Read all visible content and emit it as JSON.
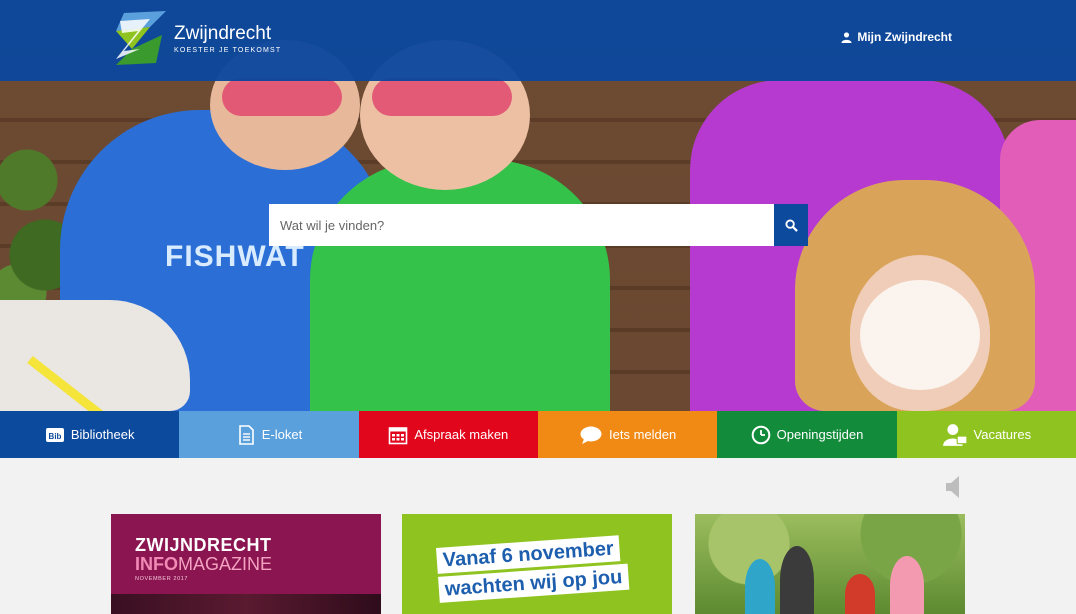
{
  "header": {
    "logo_name": "Zwijndrecht",
    "logo_tagline": "KOESTER JE TOEKOMST",
    "account_label": "Mijn Zwijndrecht"
  },
  "search": {
    "placeholder": "Wat wil je vinden?"
  },
  "hero": {
    "shirt_text": "FISHWAT"
  },
  "tiles": [
    {
      "label": "Bibliotheek",
      "icon": "library-icon",
      "color": "#0c4a9d"
    },
    {
      "label": "E-loket",
      "icon": "document-icon",
      "color": "#5aa0dc"
    },
    {
      "label": "Afspraak maken",
      "icon": "calendar-icon",
      "color": "#e1061b"
    },
    {
      "label": "Iets melden",
      "icon": "speech-bubble-icon",
      "color": "#f08a15"
    },
    {
      "label": "Openingstijden",
      "icon": "clock-icon",
      "color": "#128b3b"
    },
    {
      "label": "Vacatures",
      "icon": "person-icon",
      "color": "#8fc31f"
    }
  ],
  "cards": [
    {
      "title": "ZWIJNDRECHT",
      "sub_a": "INFO",
      "sub_b": "MAGAZINE",
      "month": "NOVEMBER 2017"
    },
    {
      "line1": "Vanaf 6 november",
      "line2": "wachten wij op jou"
    },
    {
      "alt": "family-cycling-photo"
    }
  ],
  "colors": {
    "header_blue": "#0c4a9d",
    "page_bg": "#f2f2f2"
  }
}
